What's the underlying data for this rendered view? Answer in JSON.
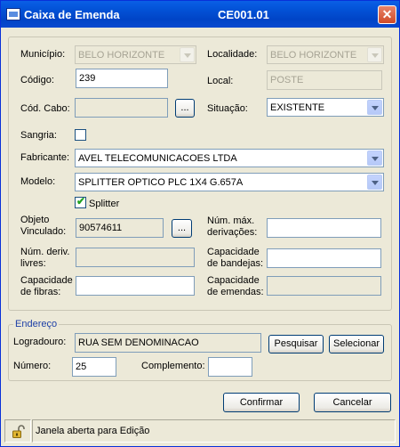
{
  "window": {
    "title": "Caixa de Emenda",
    "code": "CE001.01"
  },
  "form": {
    "municipio_label": "Município:",
    "municipio_value": "BELO HORIZONTE",
    "localidade_label": "Localidade:",
    "localidade_value": "BELO HORIZONTE",
    "codigo_label": "Código:",
    "codigo_value": "239",
    "local_label": "Local:",
    "local_value": "POSTE",
    "cod_cabo_label": "Cód. Cabo:",
    "cod_cabo_value": "",
    "ellipsis": "...",
    "situacao_label": "Situação:",
    "situacao_value": "EXISTENTE",
    "sangria_label": "Sangria:",
    "sangria_checked": false,
    "fabricante_label": "Fabricante:",
    "fabricante_value": "AVEL TELECOMUNICACOES LTDA",
    "modelo_label": "Modelo:",
    "modelo_value": "SPLITTER OPTICO PLC 1X4 G.657A",
    "splitter_label": "Splitter",
    "splitter_checked": true,
    "objeto_label_1": "Objeto",
    "objeto_label_2": "Vinculado:",
    "objeto_value": "90574611",
    "num_max_label_1": "Núm. máx.",
    "num_max_label_2": "derivações:",
    "num_max_value": "",
    "num_deriv_label_1": "Núm. deriv.",
    "num_deriv_label_2": "livres:",
    "num_deriv_value": "",
    "cap_bandejas_label_1": "Capacidade",
    "cap_bandejas_label_2": "de bandejas:",
    "cap_bandejas_value": "",
    "cap_fibras_label_1": "Capacidade",
    "cap_fibras_label_2": "de fibras:",
    "cap_fibras_value": "",
    "cap_emendas_label_1": "Capacidade",
    "cap_emendas_label_2": "de emendas:",
    "cap_emendas_value": ""
  },
  "endereco": {
    "legend": "Endereço",
    "logradouro_label": "Logradouro:",
    "logradouro_value": "RUA  SEM DENOMINACAO",
    "pesquisar": "Pesquisar",
    "selecionar": "Selecionar",
    "numero_label": "Número:",
    "numero_value": "25",
    "complemento_label": "Complemento:",
    "complemento_value": ""
  },
  "actions": {
    "confirmar": "Confirmar",
    "cancelar": "Cancelar"
  },
  "status": {
    "text": "Janela aberta para Edição",
    "icon": "padlock-open-icon"
  },
  "colors": {
    "titlebar": "#0353d8",
    "face": "#ece9d8",
    "legend": "#1d3fa6",
    "close": "#d04a28"
  }
}
